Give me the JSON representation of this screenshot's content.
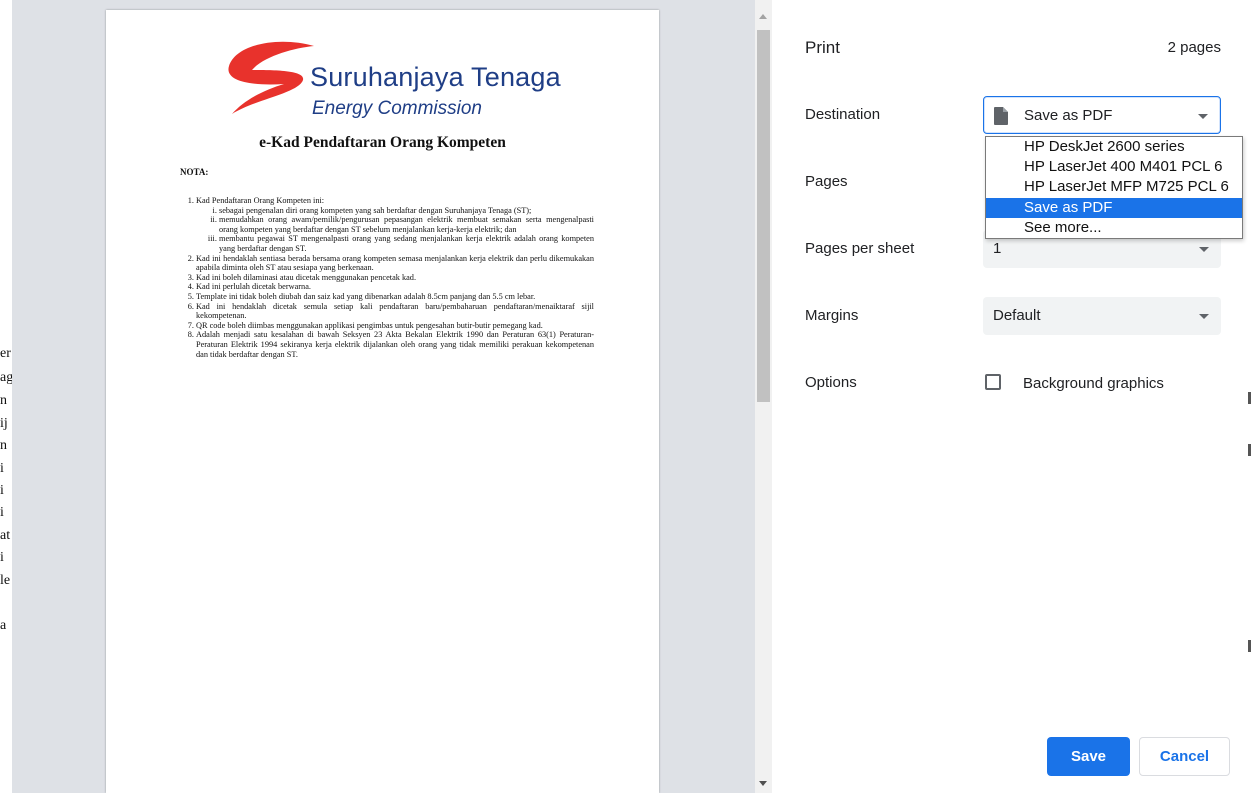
{
  "background_fragments": [
    "er",
    "ag",
    "n",
    "ij",
    "n",
    "i",
    "i",
    "i",
    "at",
    "i",
    "le",
    "a"
  ],
  "preview": {
    "logo": {
      "name": "Suruhanjaya Tenaga",
      "subtitle": "Energy Commission",
      "colors": {
        "swoosh": "#e8322c",
        "text": "#1f3e86"
      }
    },
    "title": "e-Kad Pendaftaran Orang Kompeten",
    "nota_label": "NOTA:",
    "notes": [
      "Kad Pendaftaran Orang Kompeten ini:",
      "Kad ini hendaklah sentiasa berada bersama orang kompeten semasa menjalankan kerja elektrik dan perlu dikemukakan apabila diminta oleh ST atau sesiapa yang berkenaan.",
      "Kad ini boleh dilaminasi atau dicetak menggunakan pencetak kad.",
      "Kad ini perlulah dicetak berwarna.",
      "Template ini tidak boleh diubah dan saiz kad yang dibenarkan adalah 8.5cm panjang dan 5.5 cm lebar.",
      "Kad ini hendaklah dicetak semula setiap kali pendaftaran baru/pembaharuan pendaftaran/menaiktaraf sijil kekompetenan.",
      "QR code boleh diimbas menggunakan applikasi pengimbas untuk pengesahan butir-butir pemegang kad.",
      "Adalah menjadi satu kesalahan di bawah Seksyen 23 Akta Bekalan Elektrik 1990 dan Peraturan 63(1) Peraturan-Peraturan Elektrik 1994 sekiranya kerja elektrik dijalankan oleh orang yang tidak memiliki perakuan kekompetenan dan tidak berdaftar dengan ST."
    ],
    "subnotes": [
      "sebagai pengenalan diri orang kompeten yang sah berdaftar dengan Suruhanjaya Tenaga (ST);",
      "memudahkan orang awam/pemilik/pengurusan pepasangan elektrik membuat semakan serta mengenalpasti orang kompeten yang berdaftar dengan ST sebelum menjalankan kerja-kerja elektrik; dan",
      "membantu pegawai ST mengenalpasti orang yang sedang menjalankan kerja elektrik adalah orang kompeten yang berdaftar dengan ST."
    ]
  },
  "print": {
    "title": "Print",
    "page_count": "2 pages",
    "destination_label": "Destination",
    "destination_value": "Save as PDF",
    "destination_options": [
      "HP DeskJet 2600 series",
      "HP LaserJet 400 M401 PCL 6",
      "HP LaserJet MFP M725 PCL 6",
      "Save as PDF",
      "See more..."
    ],
    "selected_option": "Save as PDF",
    "pages_label": "Pages",
    "pages_per_sheet_label": "Pages per sheet",
    "pages_per_sheet_value": "1",
    "margins_label": "Margins",
    "margins_value": "Default",
    "options_label": "Options",
    "background_graphics_label": "Background graphics",
    "background_graphics_checked": false,
    "save_label": "Save",
    "cancel_label": "Cancel"
  },
  "colors": {
    "accent": "#1a73e8",
    "preview_bg": "#dee1e6"
  }
}
